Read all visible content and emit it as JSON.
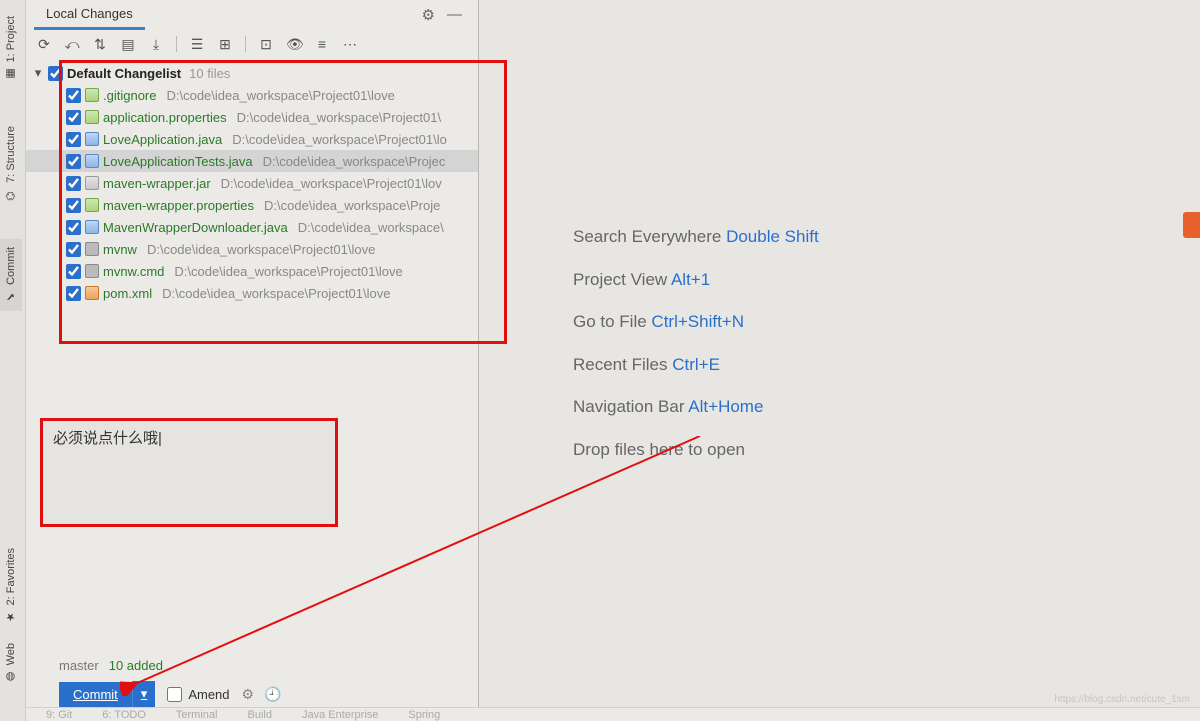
{
  "gutter": [
    {
      "label": "1: Project",
      "icon": "project"
    },
    {
      "label": "7: Structure",
      "icon": "structure"
    },
    {
      "label": "Commit",
      "icon": "commit"
    },
    {
      "label": "2: Favorites",
      "icon": "favorites"
    },
    {
      "label": "Web",
      "icon": "web"
    }
  ],
  "tab": {
    "label": "Local Changes"
  },
  "changelist": {
    "header": "Default Changelist",
    "count": "10 files",
    "files": [
      {
        "name": ".gitignore",
        "path": "D:\\code\\idea_workspace\\Project01\\love",
        "iconClass": "ic-file"
      },
      {
        "name": "application.properties",
        "path": "D:\\code\\idea_workspace\\Project01\\",
        "iconClass": "ic-file"
      },
      {
        "name": "LoveApplication.java",
        "path": "D:\\code\\idea_workspace\\Project01\\lo",
        "iconClass": "ic-java"
      },
      {
        "name": "LoveApplicationTests.java",
        "path": "D:\\code\\idea_workspace\\Projec",
        "iconClass": "ic-java",
        "selected": true
      },
      {
        "name": "maven-wrapper.jar",
        "path": "D:\\code\\idea_workspace\\Project01\\lov",
        "iconClass": "ic-jar"
      },
      {
        "name": "maven-wrapper.properties",
        "path": "D:\\code\\idea_workspace\\Proje",
        "iconClass": "ic-file"
      },
      {
        "name": "MavenWrapperDownloader.java",
        "path": "D:\\code\\idea_workspace\\",
        "iconClass": "ic-java"
      },
      {
        "name": "mvnw",
        "path": "D:\\code\\idea_workspace\\Project01\\love",
        "iconClass": "ic-sh"
      },
      {
        "name": "mvnw.cmd",
        "path": "D:\\code\\idea_workspace\\Project01\\love",
        "iconClass": "ic-sh"
      },
      {
        "name": "pom.xml",
        "path": "D:\\code\\idea_workspace\\Project01\\love",
        "iconClass": "ic-xml"
      }
    ]
  },
  "commitMessage": "必须说点什么哦|",
  "status": {
    "branch": "master",
    "added": "10 added"
  },
  "commit": {
    "label": "Commit",
    "amend": "Amend"
  },
  "hints": [
    {
      "label": "Search Everywhere",
      "shortcut": "Double Shift"
    },
    {
      "label": "Project View",
      "shortcut": "Alt+1"
    },
    {
      "label": "Go to File",
      "shortcut": "Ctrl+Shift+N"
    },
    {
      "label": "Recent Files",
      "shortcut": "Ctrl+E"
    },
    {
      "label": "Navigation Bar",
      "shortcut": "Alt+Home"
    },
    {
      "label": "Drop files here to open",
      "shortcut": ""
    }
  ],
  "bottom": [
    "9: Git",
    "6: TODO",
    "Terminal",
    "Build",
    "Java Enterprise",
    "Spring"
  ],
  "watermark": "https://blog.csdn.net/cute_1sm"
}
